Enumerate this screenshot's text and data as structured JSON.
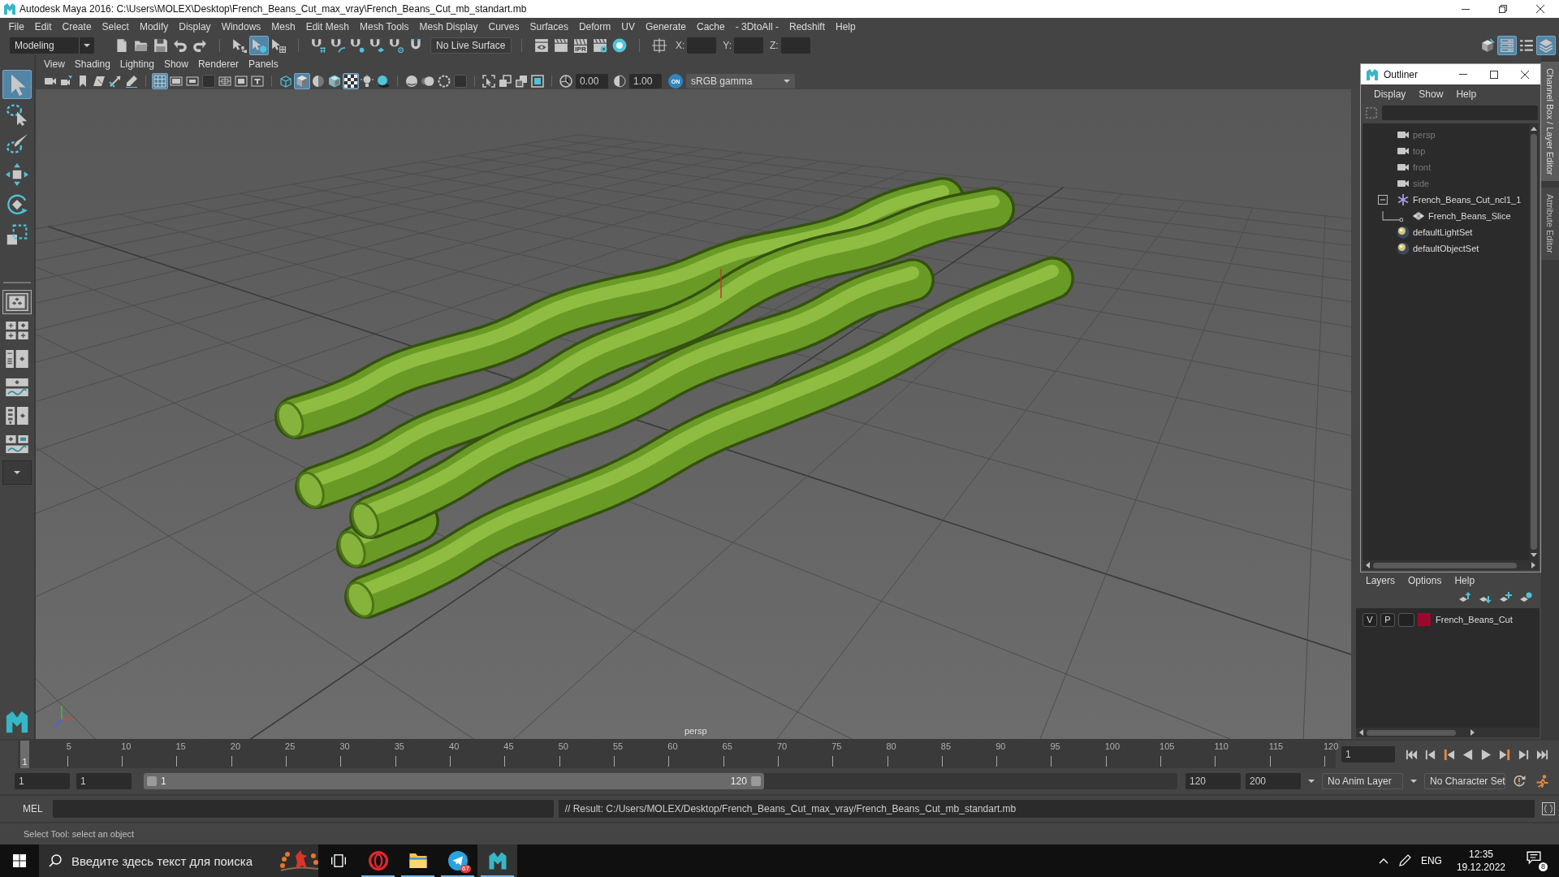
{
  "window": {
    "title": "Autodesk Maya 2016: C:\\Users\\MOLEX\\Desktop\\French_Beans_Cut_max_vray\\French_Beans_Cut_mb_standart.mb"
  },
  "menu_bar": [
    "File",
    "Edit",
    "Create",
    "Select",
    "Modify",
    "Display",
    "Windows",
    "Mesh",
    "Edit Mesh",
    "Mesh Tools",
    "Mesh Display",
    "Curves",
    "Surfaces",
    "Deform",
    "UV",
    "Generate",
    "Cache",
    "- 3DtoAll -",
    "Redshift",
    "Help"
  ],
  "status_line": {
    "mode": "Modeling",
    "file_tools": [
      {
        "kind": "new"
      },
      {
        "kind": "open"
      },
      {
        "kind": "save"
      },
      {
        "kind": "undo"
      },
      {
        "kind": "redo"
      }
    ],
    "select_tools": [
      {
        "kind": "hierarchy",
        "selected": false
      },
      {
        "kind": "object",
        "selected": true
      },
      {
        "kind": "component",
        "selected": false
      }
    ],
    "snap_tools": [
      {
        "kind": "snap-grid",
        "on": false
      },
      {
        "kind": "snap-curve",
        "on": false
      },
      {
        "kind": "snap-point",
        "on": false
      },
      {
        "kind": "snap-plane",
        "on": false
      },
      {
        "kind": "snap-center",
        "on": false
      },
      {
        "kind": "live",
        "on": false
      }
    ],
    "live_surface": "No Live Surface",
    "render_tools": [
      {
        "kind": "render-view"
      },
      {
        "kind": "render"
      },
      {
        "kind": "ipr",
        "label": "IPR"
      },
      {
        "kind": "render-settings"
      },
      {
        "kind": "hypershade"
      }
    ],
    "input_tools": [
      {
        "kind": "crosshair",
        "on": false
      }
    ],
    "coordinates": [
      {
        "label": "X:"
      },
      {
        "label": "Y:"
      },
      {
        "label": "Z:"
      }
    ],
    "panel_toggles": [
      {
        "kind": "toolkit",
        "on": false
      },
      {
        "kind": "channel-box",
        "on": true
      },
      {
        "kind": "attribute-editor",
        "on": false
      },
      {
        "kind": "layers",
        "on": true
      }
    ]
  },
  "toolbox": {
    "tools": [
      {
        "kind": "select",
        "selected": true
      },
      {
        "kind": "lasso",
        "selected": false
      },
      {
        "kind": "paint",
        "selected": false
      },
      {
        "kind": "move",
        "selected": false
      },
      {
        "kind": "rotate",
        "selected": false
      },
      {
        "kind": "scale",
        "selected": false
      }
    ],
    "layouts": [
      {
        "kind": "single",
        "selected": true
      },
      {
        "kind": "four",
        "selected": false
      },
      {
        "kind": "list",
        "selected": false
      },
      {
        "kind": "graph",
        "selected": false
      },
      {
        "kind": "outliner",
        "selected": false
      },
      {
        "kind": "three",
        "selected": false
      },
      {
        "kind": "more",
        "selected": false
      }
    ]
  },
  "viewport": {
    "menu": [
      "View",
      "Shading",
      "Lighting",
      "Show",
      "Renderer",
      "Panels"
    ],
    "camera_tools": [
      {
        "kind": "camera"
      },
      {
        "kind": "camera-attributes"
      },
      {
        "kind": "bookmark"
      },
      {
        "kind": "image-plane"
      },
      {
        "kind": "pan-zoom"
      },
      {
        "kind": "grease-pencil"
      }
    ],
    "display_toggles": [
      {
        "kind": "grid",
        "on": true
      },
      {
        "kind": "film-gate",
        "on": false
      },
      {
        "kind": "resolution-gate",
        "on": false
      },
      {
        "kind": "gate-mask",
        "on": false
      },
      {
        "kind": "field-chart",
        "on": false
      },
      {
        "kind": "safe-action",
        "on": false
      },
      {
        "kind": "safe-title",
        "on": false
      }
    ],
    "shading_toggles": [
      {
        "kind": "wireframe",
        "on": false
      },
      {
        "kind": "smooth",
        "on": true
      },
      {
        "kind": "default-material",
        "on": false
      },
      {
        "kind": "wire-on-shaded",
        "on": false
      },
      {
        "kind": "textured",
        "on": true
      },
      {
        "kind": "lights",
        "on": false
      },
      {
        "kind": "shadows",
        "on": false
      }
    ],
    "render_toggles": [
      {
        "kind": "ao",
        "on": false
      },
      {
        "kind": "motion-blur",
        "on": false
      },
      {
        "kind": "antialias",
        "on": false
      },
      {
        "kind": "dof",
        "on": false
      }
    ],
    "isolate_toggles": [
      {
        "kind": "isolate",
        "on": false
      },
      {
        "kind": "xray",
        "on": false
      },
      {
        "kind": "xray-joints",
        "on": false
      },
      {
        "kind": "xray-components",
        "on": false
      }
    ],
    "exposure": "0.00",
    "gamma": "1.00",
    "color_management": {
      "label": "ON",
      "on": true
    },
    "view_transform": "sRGB gamma",
    "camera_label": "persp"
  },
  "outliner": {
    "title": "Outliner",
    "menu": [
      "Display",
      "Show",
      "Help"
    ],
    "items": [
      {
        "kind": "camera",
        "label": "persp",
        "dimmed": true,
        "selected": false,
        "expanded": false
      },
      {
        "kind": "camera",
        "label": "top",
        "dimmed": true,
        "selected": false,
        "expanded": false
      },
      {
        "kind": "camera",
        "label": "front",
        "dimmed": true,
        "selected": false,
        "expanded": false
      },
      {
        "kind": "camera",
        "label": "side",
        "dimmed": true,
        "selected": false,
        "expanded": false
      },
      {
        "kind": "transform",
        "label": "French_Beans_Cut_ncl1_1",
        "dimmed": false,
        "selected": false,
        "expanded": true,
        "children": [
          {
            "kind": "mesh",
            "label": "French_Beans_Slice",
            "dimmed": false,
            "selected": false,
            "expanded": false
          }
        ]
      },
      {
        "kind": "set",
        "label": "defaultLightSet",
        "dimmed": false,
        "selected": false,
        "expanded": false
      },
      {
        "kind": "set",
        "label": "defaultObjectSet",
        "dimmed": false,
        "selected": false,
        "expanded": false
      }
    ]
  },
  "side_tabs": [
    {
      "label": "Channel Box / Layer Editor",
      "selected": true
    },
    {
      "label": "Attribute Editor",
      "selected": false
    }
  ],
  "layer_editor": {
    "menu": [
      "Layers",
      "Options",
      "Help"
    ],
    "layers": [
      {
        "visibility": "V",
        "playback": "P",
        "color": "#9b0a2c",
        "name": "French_Beans_Cut"
      }
    ]
  },
  "timeline": {
    "ticks": [
      "5",
      "10",
      "15",
      "20",
      "25",
      "30",
      "35",
      "40",
      "45",
      "50",
      "55",
      "60",
      "65",
      "70",
      "75",
      "80",
      "85",
      "90",
      "95",
      "100",
      "105",
      "110",
      "115",
      "120"
    ],
    "current_marker": "1",
    "level": 0,
    "current_frame": "1"
  },
  "range": {
    "start": "1",
    "playback_start": "1",
    "level": 0.6,
    "slider_start": "1",
    "slider_end": "120",
    "playback_end": "120",
    "end": "200",
    "anim_layer": "No Anim Layer",
    "character_set": "No Character Set"
  },
  "command_line": {
    "language": "MEL",
    "result": "// Result: C:/Users/MOLEX/Desktop/French_Beans_Cut_max_vray/French_Beans_Cut_mb_standart.mb"
  },
  "help_line": "Select Tool: select an object",
  "taskbar": {
    "search": {
      "placeholder": "Введите здесь текст для поиска"
    },
    "apps": [
      {
        "kind": "task-view",
        "running": false,
        "active": false
      },
      {
        "kind": "opera",
        "running": true,
        "active": false
      },
      {
        "kind": "explorer",
        "running": true,
        "active": false
      },
      {
        "kind": "telegram",
        "running": true,
        "active": false,
        "badge": "67"
      },
      {
        "kind": "maya",
        "running": true,
        "active": true
      }
    ],
    "language": "ENG",
    "time": "12:35",
    "date": "19.12.2022",
    "notifications": "8"
  }
}
